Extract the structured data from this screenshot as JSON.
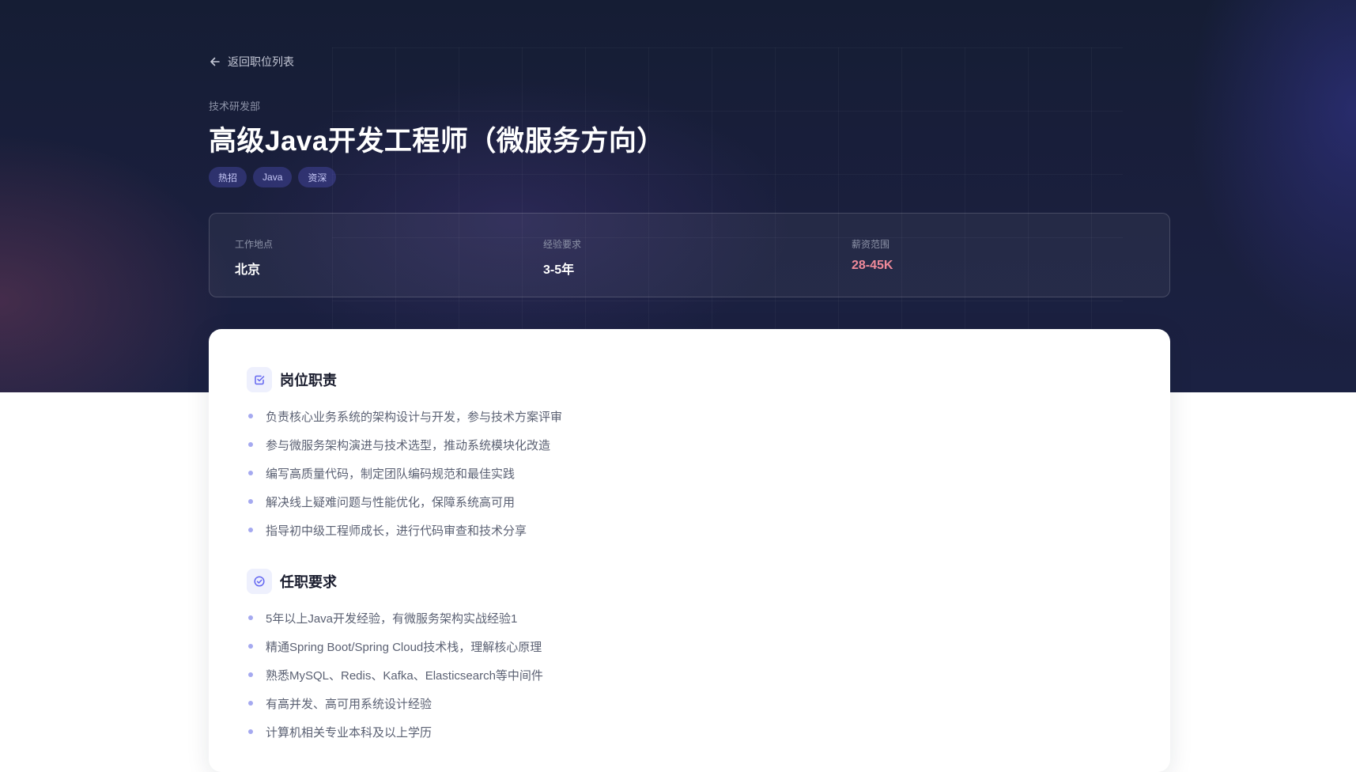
{
  "nav": {
    "back_label": "返回职位列表"
  },
  "job": {
    "department": "技术研发部",
    "title": "高级Java开发工程师（微服务方向）",
    "tags": [
      "热招",
      "Java",
      "资深"
    ]
  },
  "info": {
    "location": {
      "label": "工作地点",
      "value": "北京"
    },
    "experience": {
      "label": "经验要求",
      "value": "3-5年"
    },
    "salary": {
      "label": "薪资范围",
      "value": "28-45K"
    }
  },
  "responsibilities": {
    "title": "岗位职责",
    "icon": "checkbox-icon",
    "items": [
      "负责核心业务系统的架构设计与开发，参与技术方案评审",
      "参与微服务架构演进与技术选型，推动系统模块化改造",
      "编写高质量代码，制定团队编码规范和最佳实践",
      "解决线上疑难问题与性能优化，保障系统高可用",
      "指导初中级工程师成长，进行代码审查和技术分享"
    ]
  },
  "requirements": {
    "title": "任职要求",
    "icon": "check-circle-icon",
    "items": [
      "5年以上Java开发经验，有微服务架构实战经验1",
      "精通Spring Boot/Spring Cloud技术栈，理解核心原理",
      "熟悉MySQL、Redis、Kafka、Elasticsearch等中间件",
      "有高并发、高可用系统设计经验",
      "计算机相关专业本科及以上学历"
    ]
  },
  "colors": {
    "accent": "#6366f1",
    "salary": "#f08a9a",
    "hero_bg": "#1a1f3d"
  }
}
